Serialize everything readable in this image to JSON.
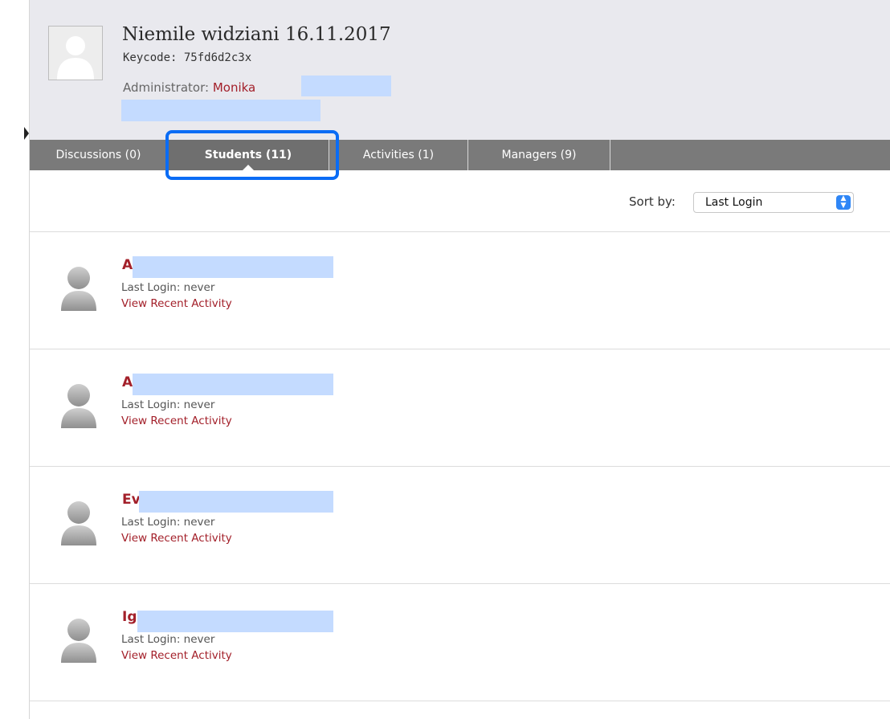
{
  "group": {
    "title": "Niemile widziani 16.11.2017",
    "keycode": "Keycode: 75fd6d2c3x",
    "admin_label": "Administrator:",
    "admin_name": "Monika"
  },
  "tabs": [
    {
      "label": "Discussions (0)"
    },
    {
      "label": "Students (11)"
    },
    {
      "label": "Activities (1)"
    },
    {
      "label": "Managers (9)"
    }
  ],
  "sort": {
    "label": "Sort by:",
    "selected": "Last Login"
  },
  "students": [
    {
      "name": "A",
      "last_login": "Last Login: never",
      "activity_link": "View Recent Activity"
    },
    {
      "name": "A",
      "last_login": "Last Login: never",
      "activity_link": "View Recent Activity"
    },
    {
      "name": "Ev",
      "last_login": "Last Login: never",
      "activity_link": "View Recent Activity"
    },
    {
      "name": "Ig",
      "last_login": "Last Login: never",
      "activity_link": "View Recent Activity"
    }
  ],
  "colors": {
    "accent_red": "#a3202a",
    "tab_bar": "#7a7a7a",
    "highlight_blue": "#0a6cf5",
    "redaction": "#c4dbff"
  }
}
